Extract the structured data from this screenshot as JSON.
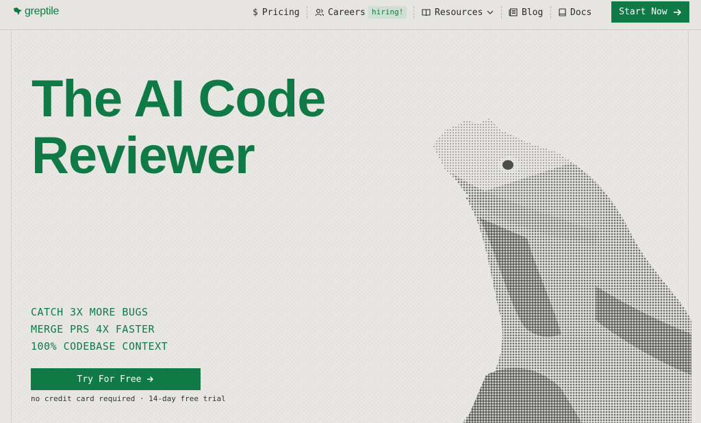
{
  "brand": {
    "name": "greptile",
    "color": "#0f7a45"
  },
  "nav": {
    "pricing": {
      "icon": "dollar-icon",
      "label": "Pricing"
    },
    "careers": {
      "icon": "users-icon",
      "label": "Careers",
      "badge": "hiring!"
    },
    "resources": {
      "icon": "book-open-icon",
      "label": "Resources"
    },
    "blog": {
      "icon": "newspaper-icon",
      "label": "Blog"
    },
    "docs": {
      "icon": "book-icon",
      "label": "Docs"
    },
    "cta": "Start Now"
  },
  "hero": {
    "headline_line1": "The AI Code",
    "headline_line2": "Reviewer",
    "features": [
      "CATCH 3X MORE BUGS",
      "MERGE PRS 4X FASTER",
      "100% CODEBASE CONTEXT"
    ],
    "cta": "Try For Free",
    "note": "no credit card required · 14-day free trial"
  }
}
